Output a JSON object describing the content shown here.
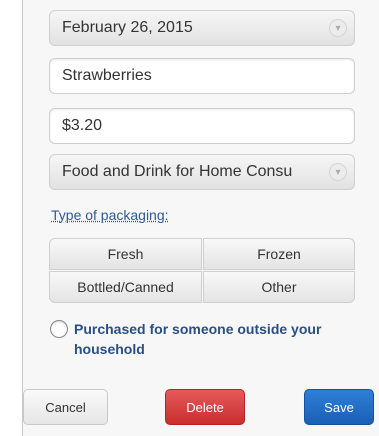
{
  "form": {
    "date_value": "February 26, 2015",
    "item_value": "Strawberries",
    "price_value": "$3.20",
    "category_value": "Food and Drink for Home Consu"
  },
  "packaging": {
    "label": "Type of packaging:",
    "options": [
      "Fresh",
      "Frozen",
      "Bottled/Canned",
      "Other"
    ]
  },
  "checkbox": {
    "label": "Purchased for someone outside your household",
    "checked": false
  },
  "actions": {
    "cancel_label": "Cancel",
    "delete_label": "Delete",
    "save_label": "Save"
  },
  "colors": {
    "delete": "#c82e2e",
    "save": "#1a5fb5",
    "link": "#2c5a9c"
  },
  "icons": {
    "select_arrow": "chevron-down-icon"
  }
}
